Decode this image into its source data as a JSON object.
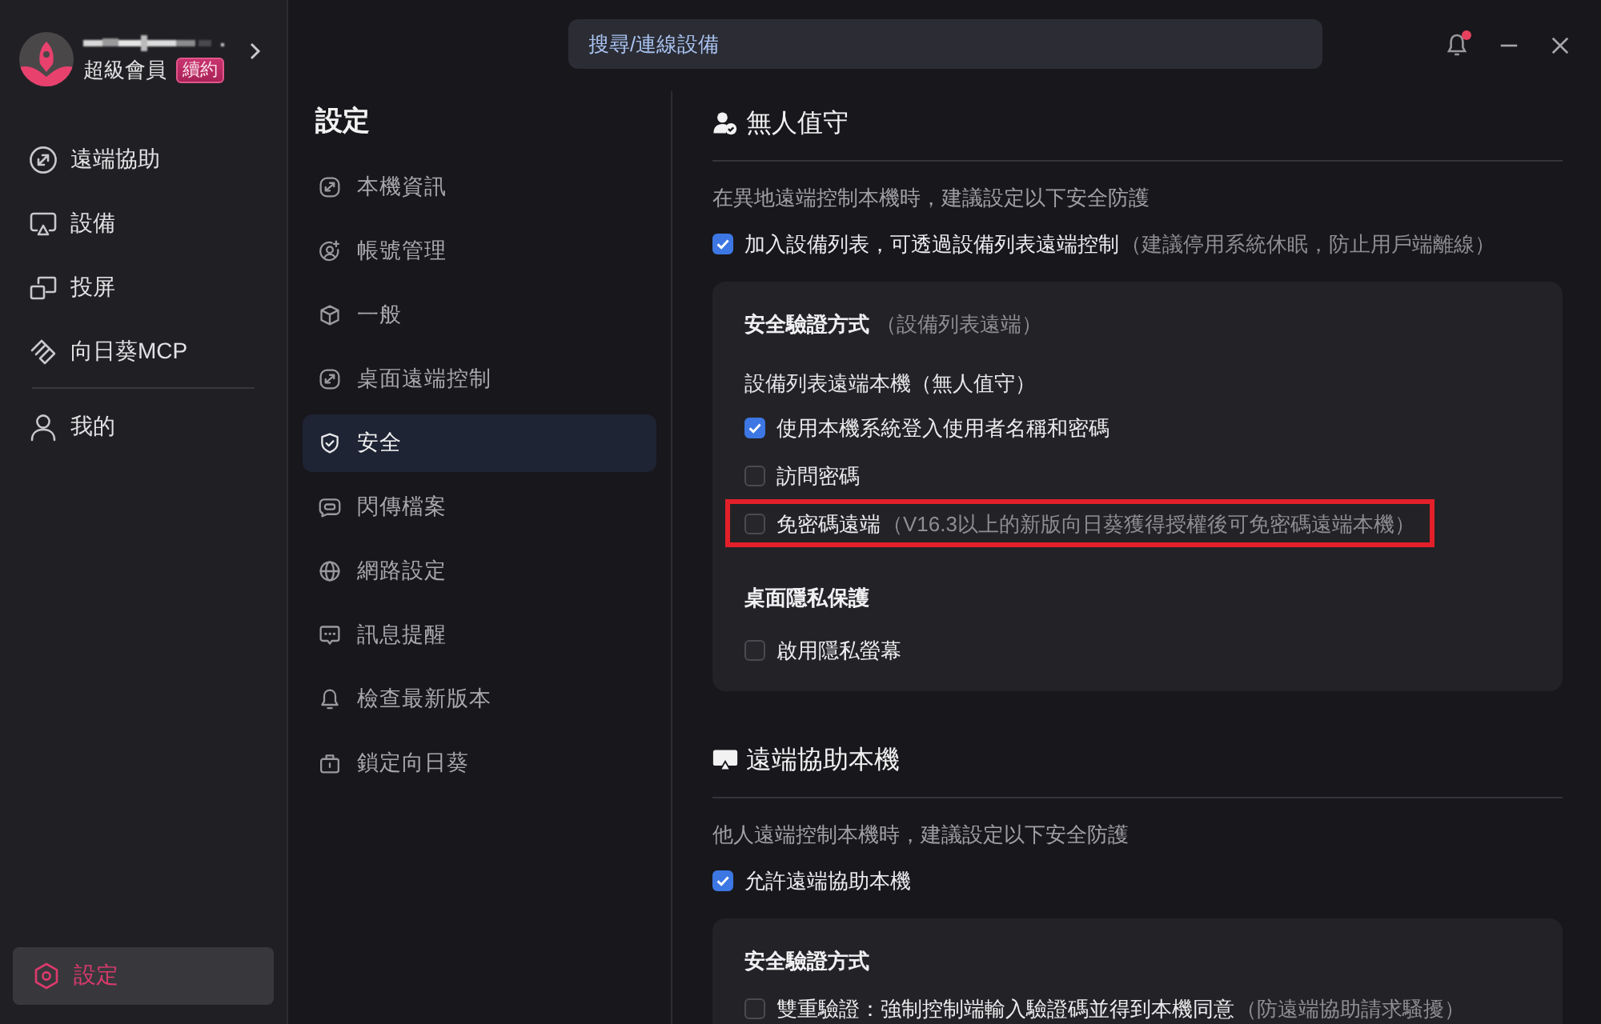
{
  "window": {
    "search": {
      "placeholder": "搜尋/連線設備"
    },
    "notifications": {
      "unread": true
    }
  },
  "account": {
    "tier": "超級會員",
    "badge": "續約"
  },
  "nav": {
    "groups": [
      [
        {
          "label": "遠端協助",
          "selected": false
        },
        {
          "label": "設備",
          "selected": false
        },
        {
          "label": "投屏",
          "selected": false
        },
        {
          "label": "向日葵MCP",
          "selected": false
        }
      ],
      [
        {
          "label": "我的",
          "selected": false
        }
      ]
    ],
    "footer": {
      "label": "設定",
      "selected": true
    }
  },
  "settings_menu": {
    "title": "設定",
    "items": [
      {
        "label": "本機資訊",
        "selected": false
      },
      {
        "label": "帳號管理",
        "selected": false
      },
      {
        "label": "一般",
        "selected": false
      },
      {
        "label": "桌面遠端控制",
        "selected": false
      },
      {
        "label": "安全",
        "selected": true
      },
      {
        "label": "閃傳檔案",
        "selected": false
      },
      {
        "label": "網路設定",
        "selected": false
      },
      {
        "label": "訊息提醒",
        "selected": false
      },
      {
        "label": "檢查最新版本",
        "selected": false
      },
      {
        "label": "鎖定向日葵",
        "selected": false
      }
    ]
  },
  "content": {
    "sections": [
      {
        "title": "無人值守",
        "description": "在異地遠端控制本機時，建議設定以下安全防護",
        "main_option": {
          "label": "加入設備列表，可透過設備列表遠端控制",
          "note": "（建議停用系統休眠，防止用戶端離線）",
          "checked": true
        },
        "card": {
          "groups": [
            {
              "title": "安全驗證方式",
              "note": "（設備列表遠端）",
              "subtitle": "設備列表遠端本機（無人值守）",
              "options": [
                {
                  "label": "使用本機系統登入使用者名稱和密碼",
                  "checked": true
                },
                {
                  "label": "訪問密碼",
                  "checked": false
                },
                {
                  "label": "免密碼遠端",
                  "note": "（V16.3以上的新版向日葵獲得授權後可免密碼遠端本機）",
                  "checked": false,
                  "highlighted": true
                }
              ]
            },
            {
              "title": "桌面隱私保護",
              "options": [
                {
                  "label": "啟用隱私螢幕",
                  "checked": false
                }
              ]
            }
          ]
        }
      },
      {
        "title": "遠端協助本機",
        "description": "他人遠端控制本機時，建議設定以下安全防護",
        "main_option": {
          "label": "允許遠端協助本機",
          "checked": true
        },
        "card": {
          "groups": [
            {
              "title": "安全驗證方式",
              "options": [
                {
                  "label": "雙重驗證：強制控制端輸入驗證碼並得到本機同意",
                  "note": "（防遠端協助請求騷擾）",
                  "checked": false
                }
              ]
            }
          ]
        }
      }
    ]
  }
}
